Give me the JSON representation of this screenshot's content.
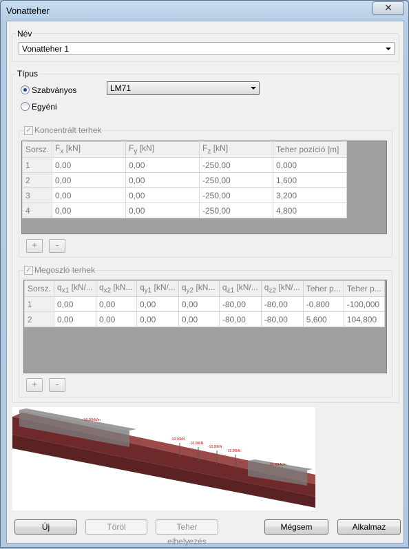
{
  "window": {
    "title": "Vonatteher",
    "close_glyph": "✕"
  },
  "nev": {
    "label": "Név",
    "value": "Vonatteher 1"
  },
  "tipus": {
    "label": "Típus",
    "radio_standard": "Szabványos",
    "radio_custom": "Egyéni",
    "standard_value": "LM71"
  },
  "concentrated": {
    "label": "Koncentrált terhek",
    "headers": [
      "Sorsz.",
      "F_x [kN]",
      "F_y [kN]",
      "F_z [kN]",
      "Teher pozíció [m]"
    ],
    "rows": [
      [
        "1",
        "0,00",
        "0,00",
        "-250,00",
        "0,000"
      ],
      [
        "2",
        "0,00",
        "0,00",
        "-250,00",
        "1,600"
      ],
      [
        "3",
        "0,00",
        "0,00",
        "-250,00",
        "3,200"
      ],
      [
        "4",
        "0,00",
        "0,00",
        "-250,00",
        "4,800"
      ]
    ],
    "add_label": "+",
    "remove_label": "-"
  },
  "distributed": {
    "label": "Megoszló terhek",
    "headers": [
      "Sorsz.",
      "q_x1 [kN/...",
      "q_x2 [kN...",
      "q_y1 [kN/...",
      "q_y2 [kN...",
      "q_z1 [kN/...",
      "q_z2 [kN/...",
      "Teher p...",
      "Teher p..."
    ],
    "rows": [
      [
        "1",
        "0,00",
        "0,00",
        "0,00",
        "0,00",
        "-80,00",
        "-80,00",
        "-0,800",
        "-100,000"
      ],
      [
        "2",
        "0,00",
        "0,00",
        "0,00",
        "0,00",
        "-80,00",
        "-80,00",
        "5,600",
        "104,800"
      ]
    ],
    "add_label": "+",
    "remove_label": "-"
  },
  "preview": {
    "dist_load_1": "-10.00kN/m",
    "dist_load_2": "-10.00kN/m",
    "point_loads": [
      "-10.00kN",
      "-10.00kN",
      "-10.00kN",
      "-10.00kN"
    ]
  },
  "buttons": {
    "new": "Új",
    "delete": "Töröl",
    "place": "Teher elhelyezés",
    "cancel": "Mégsem",
    "apply": "Alkalmaz"
  },
  "colors": {
    "beam": "#8b3a3a",
    "load_box": "#7a7a7a",
    "accent": "#1b4e8c"
  }
}
